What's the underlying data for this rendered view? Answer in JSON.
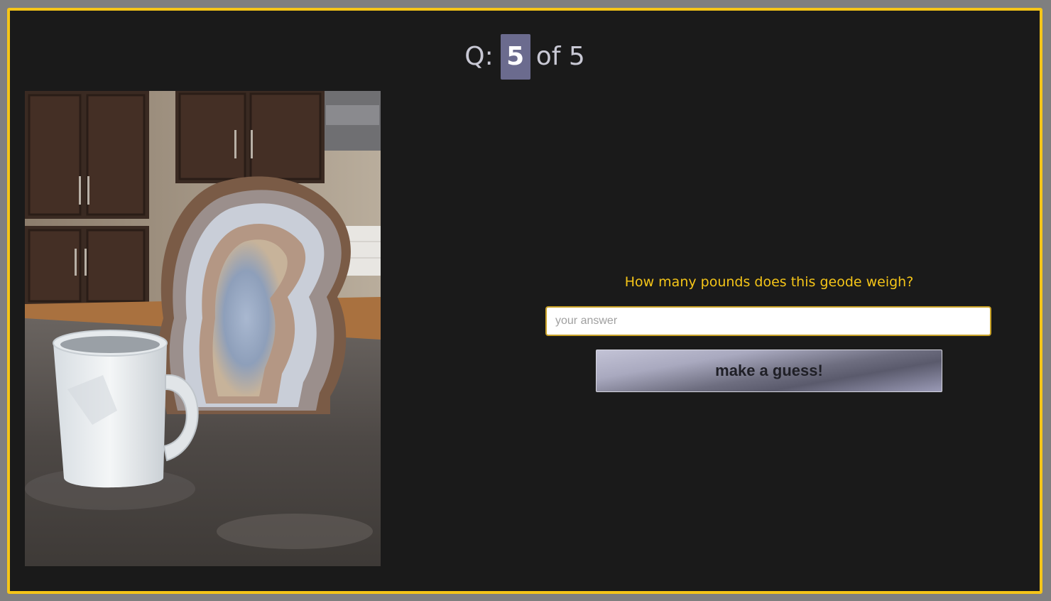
{
  "header": {
    "q_prefix": "Q:",
    "current_question": "5",
    "of_label": "of",
    "total_questions": "5"
  },
  "photo": {
    "description_icon": "geode-and-mug-photo"
  },
  "quiz": {
    "question": "How many pounds does this geode weigh?",
    "answer_placeholder": "your answer",
    "answer_value": "",
    "submit_label": "make a guess!"
  },
  "colors": {
    "background": "#1a1a1a",
    "frame_border": "#f5c518",
    "question_text": "#f5c518",
    "counter_badge": "#6b6b8e",
    "outer_bg": "#7f7f7f"
  }
}
